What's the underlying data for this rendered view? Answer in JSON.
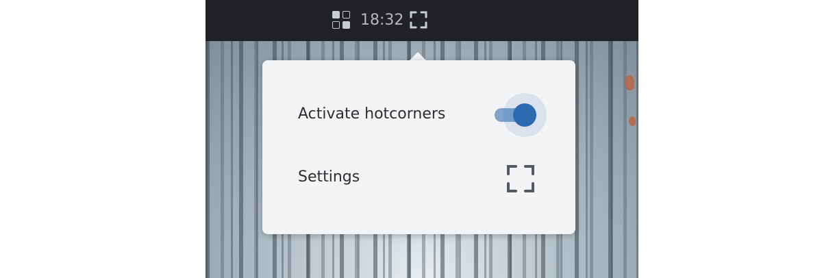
{
  "topbar": {
    "clock": "18:32",
    "background_color": "#202226",
    "apps_icon": "apps-grid-icon",
    "hotcorner_icon": "fullscreen-corners-icon"
  },
  "popover": {
    "activate": {
      "label": "Activate hotcorners",
      "enabled": true
    },
    "settings": {
      "label": "Settings",
      "icon": "fullscreen-corners-icon"
    },
    "accent_color": "#2b6ab0",
    "background_color": "#f3f4f6"
  }
}
